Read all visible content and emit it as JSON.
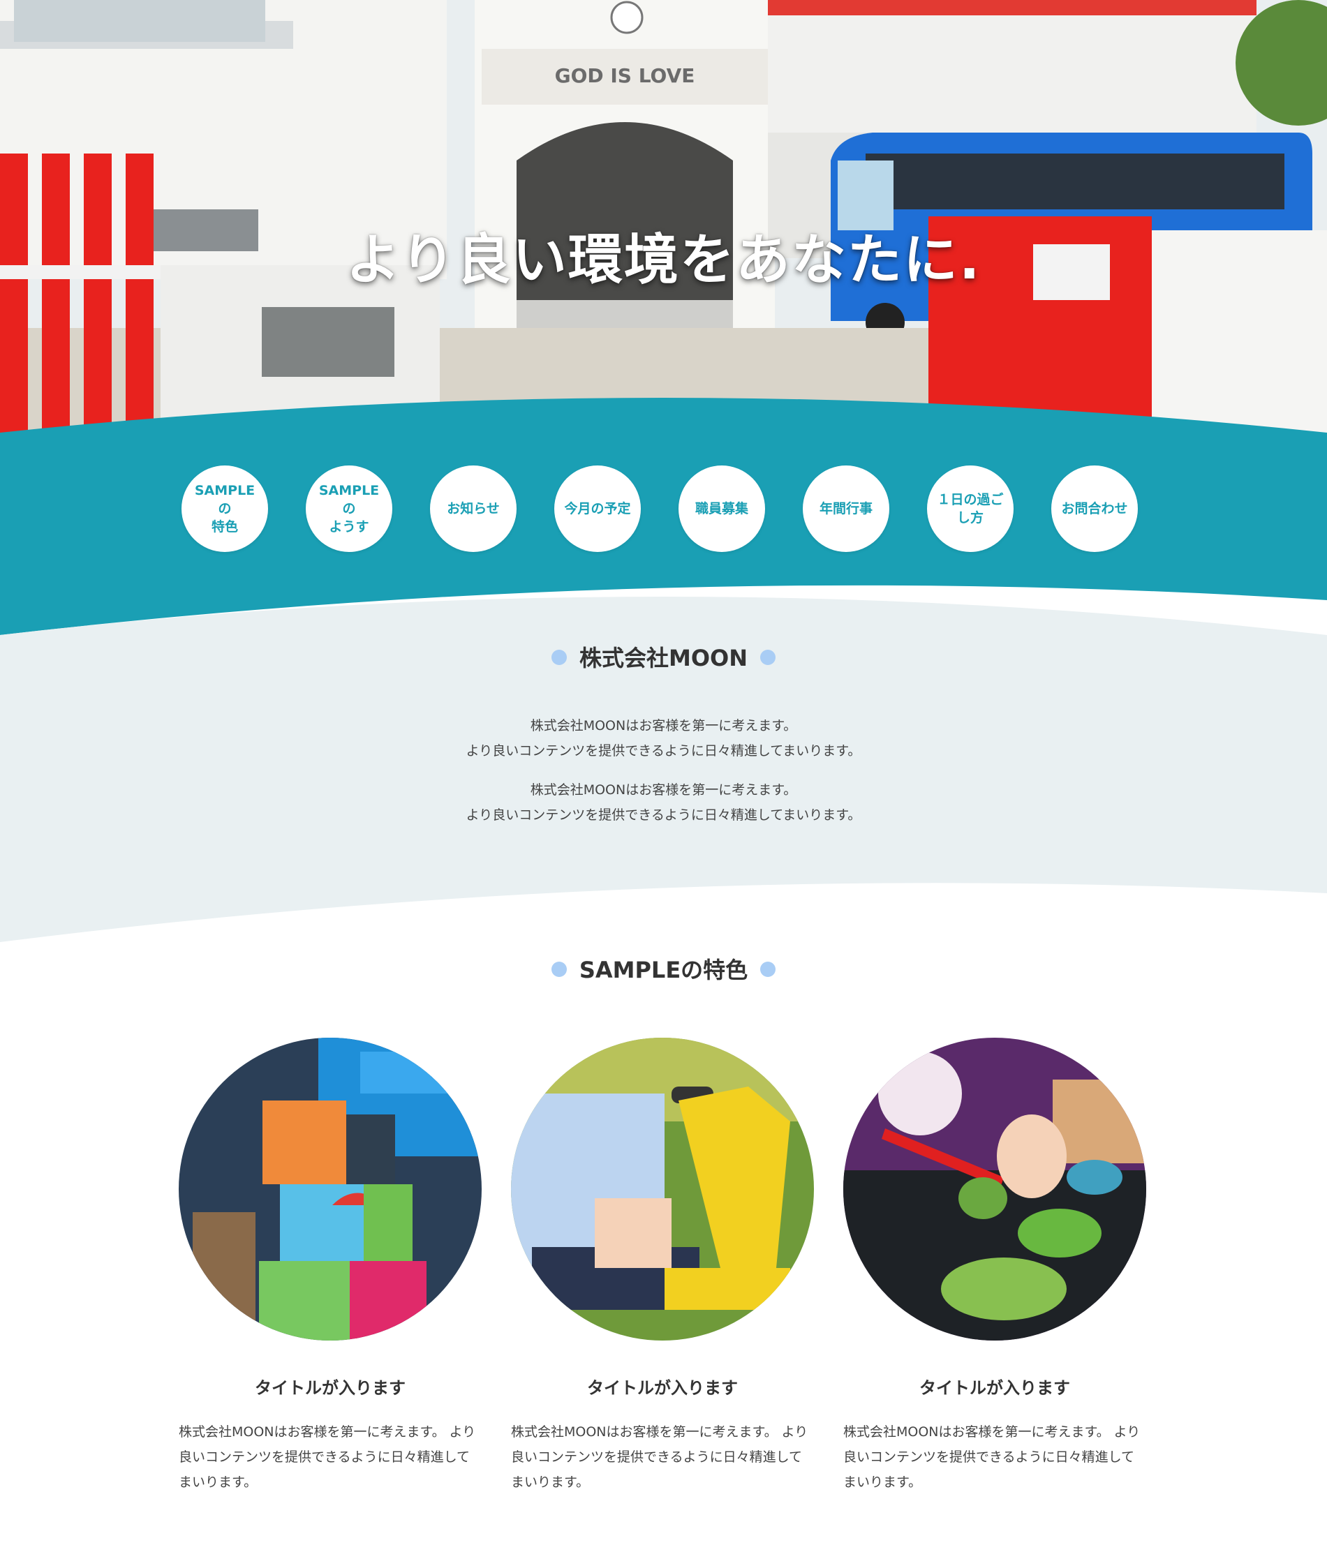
{
  "hero": {
    "title": "より良い環境をあなたに.",
    "building_sign": "GOD IS LOVE"
  },
  "nav": {
    "items": [
      {
        "label": "SAMPLEの\n特色"
      },
      {
        "label": "SAMPLEの\nようす"
      },
      {
        "label": "お知らせ"
      },
      {
        "label": "今月の予定"
      },
      {
        "label": "職員募集"
      },
      {
        "label": "年間行事"
      },
      {
        "label": "１日の過ご\nし方"
      },
      {
        "label": "お問合わせ"
      }
    ]
  },
  "about": {
    "title": "株式会社MOON",
    "paragraphs": [
      {
        "line1": "株式会社MOONはお客様を第一に考えます。",
        "line2": "より良いコンテンツを提供できるように日々精進してまいります。"
      },
      {
        "line1": "株式会社MOONはお客様を第一に考えます。",
        "line2": "より良いコンテンツを提供できるように日々精進してまいります。"
      }
    ]
  },
  "features": {
    "title": "SAMPLEの特色",
    "cards": [
      {
        "title": "タイトルが入ります",
        "text": "株式会社MOONはお客様を第一に考えます。 より良いコンテンツを提供できるように日々精進してまいります。"
      },
      {
        "title": "タイトルが入ります",
        "text": "株式会社MOONはお客様を第一に考えます。 より良いコンテンツを提供できるように日々精進してまいります。"
      },
      {
        "title": "タイトルが入ります",
        "text": "株式会社MOONはお客様を第一に考えます。 より良いコンテンツを提供できるように日々精進してまいります。"
      }
    ]
  },
  "colors": {
    "teal": "#1a9fb4",
    "light_gray_bg": "#e9f0f2",
    "dot_blue": "#a9cdf5",
    "red_fence": "#e8221e",
    "bus_blue": "#1f6fd6"
  }
}
